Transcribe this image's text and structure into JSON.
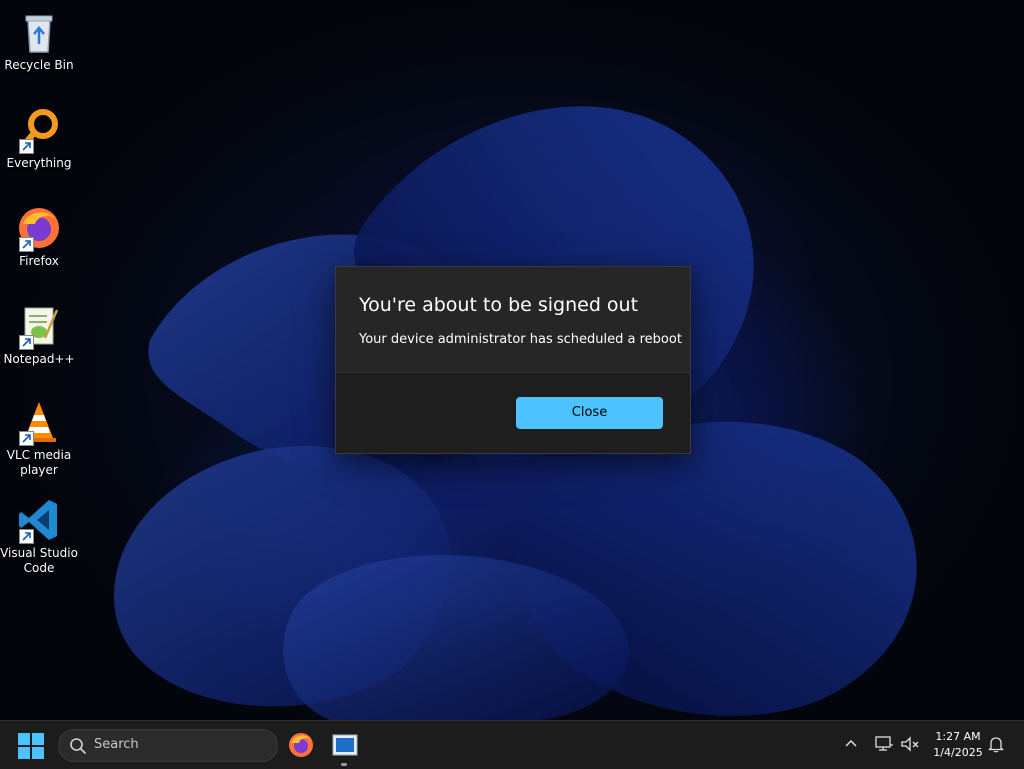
{
  "desktop": {
    "icons": [
      {
        "label": "Recycle Bin",
        "icon": "recycle-bin-icon",
        "shortcut": false
      },
      {
        "label": "Everything",
        "icon": "everything-search-icon",
        "shortcut": true
      },
      {
        "label": "Firefox",
        "icon": "firefox-icon",
        "shortcut": true
      },
      {
        "label": "Notepad++",
        "icon": "notepad-plus-plus-icon",
        "shortcut": true
      },
      {
        "label": "VLC media player",
        "icon": "vlc-icon",
        "shortcut": true
      },
      {
        "label": "Visual Studio Code",
        "icon": "vscode-icon",
        "shortcut": true
      }
    ]
  },
  "dialog": {
    "title": "You're about to be signed out",
    "message": "Your device administrator has scheduled a reboot",
    "close_label": "Close"
  },
  "taskbar": {
    "search_placeholder": "Search",
    "apps": [
      "firefox-icon",
      "window-app-icon"
    ],
    "clock_time": "1:27 AM",
    "clock_date": "1/4/2025"
  },
  "colors": {
    "accent_button": "#4cc2ff",
    "dialog_bg": "#262626",
    "taskbar_bg": "#1c1c1c"
  }
}
